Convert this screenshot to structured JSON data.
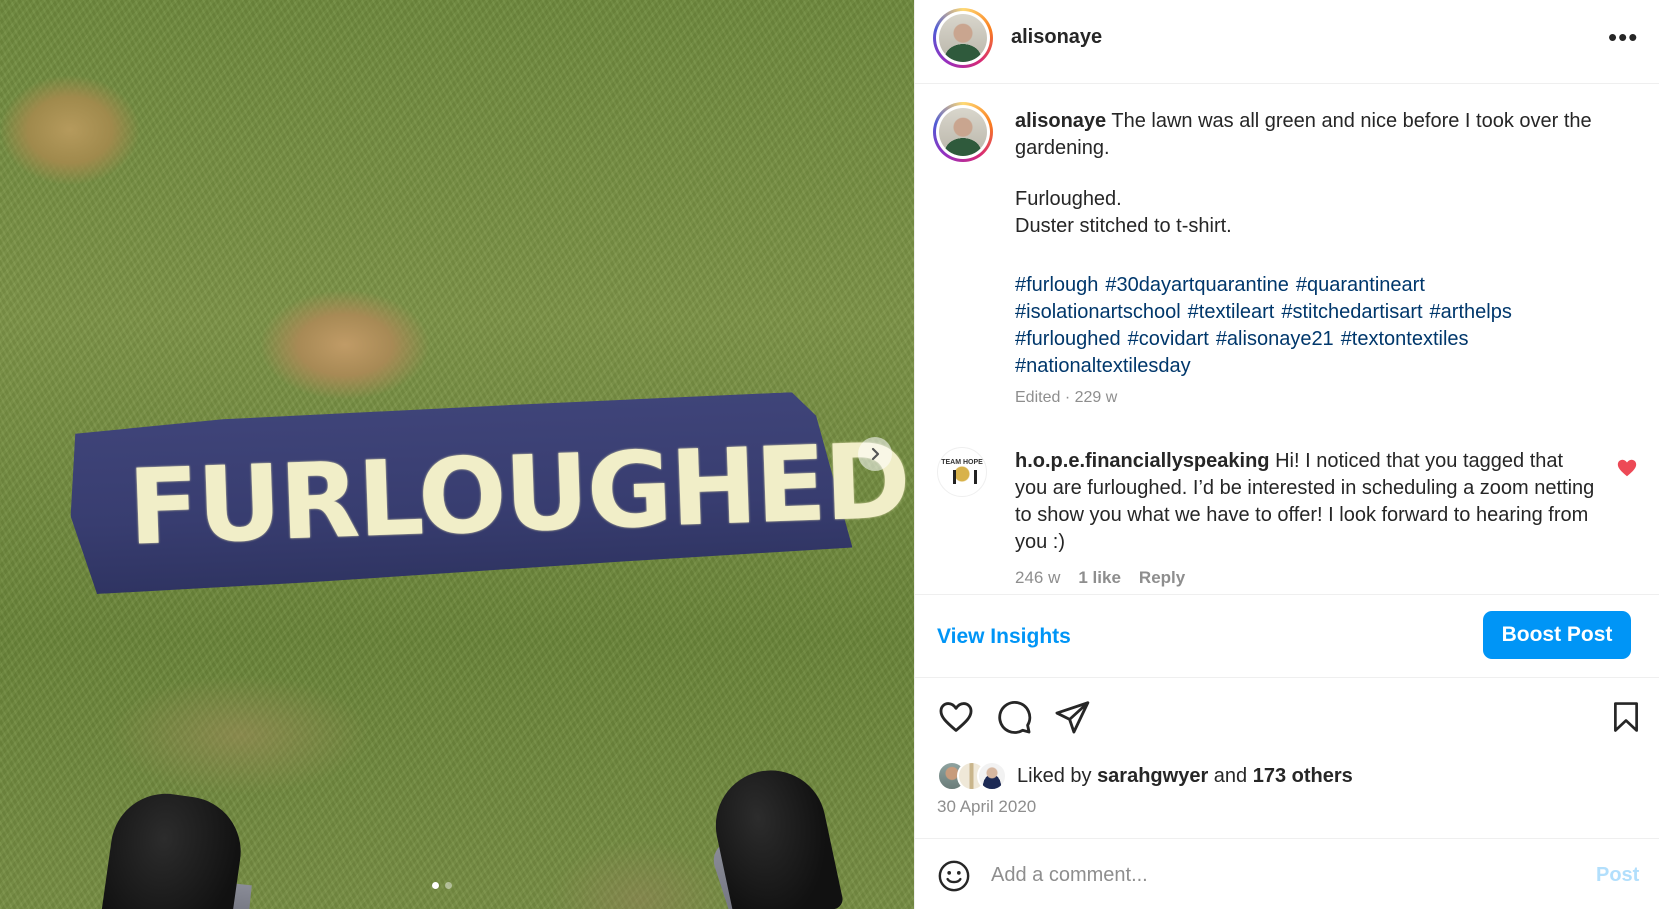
{
  "post_image": {
    "banner_text": "FURLOUGHED",
    "carousel_dots": [
      true,
      false
    ]
  },
  "header": {
    "username": "alisonaye",
    "more_label": "•••"
  },
  "caption": {
    "username": "alisonaye",
    "text_line1": "The lawn was all green and nice before I took over the gardening.",
    "text_line2": "Furloughed.",
    "text_line3": "Duster stitched to t-shirt.",
    "hashtags": [
      "#furlough",
      "#30dayartquarantine",
      "#quarantineart",
      "#isolationartschool",
      "#textileart",
      "#stitchedartisart",
      "#arthelps",
      "#furloughed",
      "#covidart",
      "#alisonaye21",
      "#textontextiles",
      "#nationaltextilesday"
    ],
    "edited": "Edited · 229 w"
  },
  "comment": {
    "username": "h.o.p.e.financiallyspeaking",
    "text": "Hi! I noticed that you tagged that you are furloughed. I’d be interested in scheduling a zoom netting to show you what we have to offer! I look forward to hearing from you :)",
    "age": "246 w",
    "likes": "1 like",
    "reply": "Reply",
    "avatar_logo_text": "TEAM HOPE",
    "liked_heart_color": "#ed4956"
  },
  "insights": {
    "view_insights": "View Insights",
    "boost_post": "Boost Post"
  },
  "actions": {
    "icons": [
      "heart-icon",
      "comment-icon",
      "share-icon",
      "bookmark-icon"
    ]
  },
  "likes": {
    "prefix": "Liked by",
    "user": "sarahgwyer",
    "conjunction": "and",
    "others": "173 others"
  },
  "date": "30 April 2020",
  "add_comment": {
    "placeholder": "Add a comment...",
    "post_label": "Post"
  },
  "colors": {
    "link_blue": "#0095f6",
    "hashtag_blue": "#00376b",
    "muted_gray": "#8e8e8e",
    "text_dark": "#262626"
  }
}
